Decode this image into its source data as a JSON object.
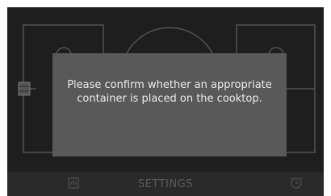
{
  "cooktop": {
    "zones": [
      "front-left",
      "rear-center",
      "front-right",
      "rear-right",
      "left-bridge"
    ]
  },
  "dialog": {
    "message": "Please confirm whether an appropriate container is placed on the cooktop."
  },
  "bottom_bar": {
    "settings_label": "SETTINGS",
    "left_icon": "hand-lock-icon",
    "right_icon": "timer-icon"
  },
  "colors": {
    "screen_bg": "#1e1e1e",
    "dialog_bg": "#595959",
    "dialog_text": "#ececec",
    "zone_outline": "#525252",
    "bar_text": "#5a5a5a"
  }
}
